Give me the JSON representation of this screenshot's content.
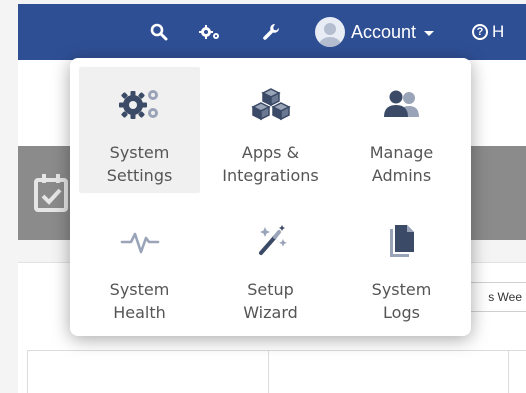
{
  "topbar": {
    "account_label": "Account",
    "help_label": "H",
    "icons": [
      "search-icon",
      "gears-icon",
      "wrench-icon",
      "avatar-icon",
      "help-icon"
    ],
    "background": "#2f4f95"
  },
  "menu": {
    "items": [
      {
        "line1": "System",
        "line2": "Settings",
        "icon": "gears-icon",
        "active": true
      },
      {
        "line1": "Apps &",
        "line2": "Integrations",
        "icon": "cubes-icon",
        "active": false
      },
      {
        "line1": "Manage",
        "line2": "Admins",
        "icon": "users-icon",
        "active": false
      },
      {
        "line1": "System",
        "line2": "Health",
        "icon": "heartbeat-icon",
        "active": false
      },
      {
        "line1": "Setup",
        "line2": "Wizard",
        "icon": "magic-wand-icon",
        "active": false
      },
      {
        "line1": "System",
        "line2": "Logs",
        "icon": "files-icon",
        "active": false
      }
    ]
  },
  "background_page": {
    "range_button_label": "s Wee",
    "calendar_icon": "calendar-check-icon"
  },
  "colors": {
    "icon_dark": "#3b4a66",
    "icon_light": "#9aa4b8",
    "label": "#555555"
  }
}
